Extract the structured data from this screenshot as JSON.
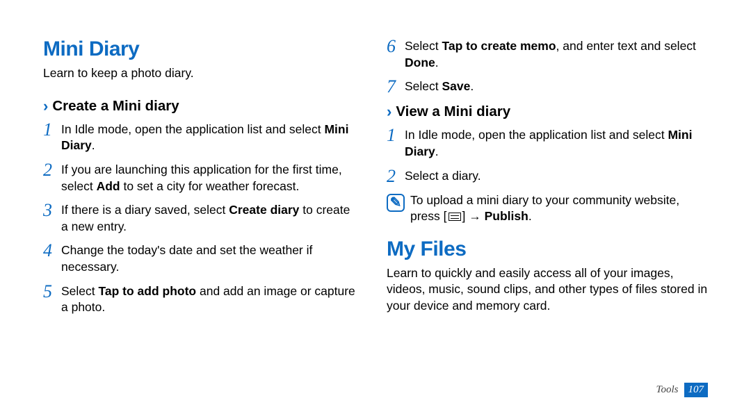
{
  "left": {
    "h1": "Mini Diary",
    "intro": "Learn to keep a photo diary.",
    "h2": "Create a Mini diary",
    "steps": [
      {
        "n": "1",
        "pre": "In Idle mode, open the application list and select ",
        "bold": "Mini Diary",
        "post": "."
      },
      {
        "n": "2",
        "pre": "If you are launching this application for the first time, select ",
        "bold": "Add",
        "post": " to set a city for weather forecast."
      },
      {
        "n": "3",
        "pre": "If there is a diary saved, select ",
        "bold": "Create diary",
        "post": " to create a new entry."
      },
      {
        "n": "4",
        "pre": "Change the today's date and set the weather if necessary.",
        "bold": "",
        "post": ""
      },
      {
        "n": "5",
        "pre": "Select ",
        "bold": "Tap to add photo",
        "post": " and add an image or capture a photo."
      }
    ]
  },
  "right": {
    "cont_steps": [
      {
        "n": "6",
        "pre": "Select ",
        "bold": "Tap to create memo",
        "post": ", and enter text and select ",
        "bold2": "Done",
        "post2": "."
      },
      {
        "n": "7",
        "pre": "Select ",
        "bold": "Save",
        "post": "."
      }
    ],
    "h2": "View a Mini diary",
    "view_steps": [
      {
        "n": "1",
        "pre": "In Idle mode, open the application list and select ",
        "bold": "Mini Diary",
        "post": "."
      },
      {
        "n": "2",
        "pre": "Select a diary.",
        "bold": "",
        "post": ""
      }
    ],
    "note_pre": "To upload a mini diary to your community website, press [",
    "note_mid": "] → ",
    "note_bold": "Publish",
    "note_post": ".",
    "h1_files": "My Files",
    "intro_files": "Learn to quickly and easily access all of your images, videos, music, sound clips, and other types of files stored in your device and memory card."
  },
  "footer": {
    "label": "Tools",
    "page": "107"
  },
  "chevron": "›"
}
